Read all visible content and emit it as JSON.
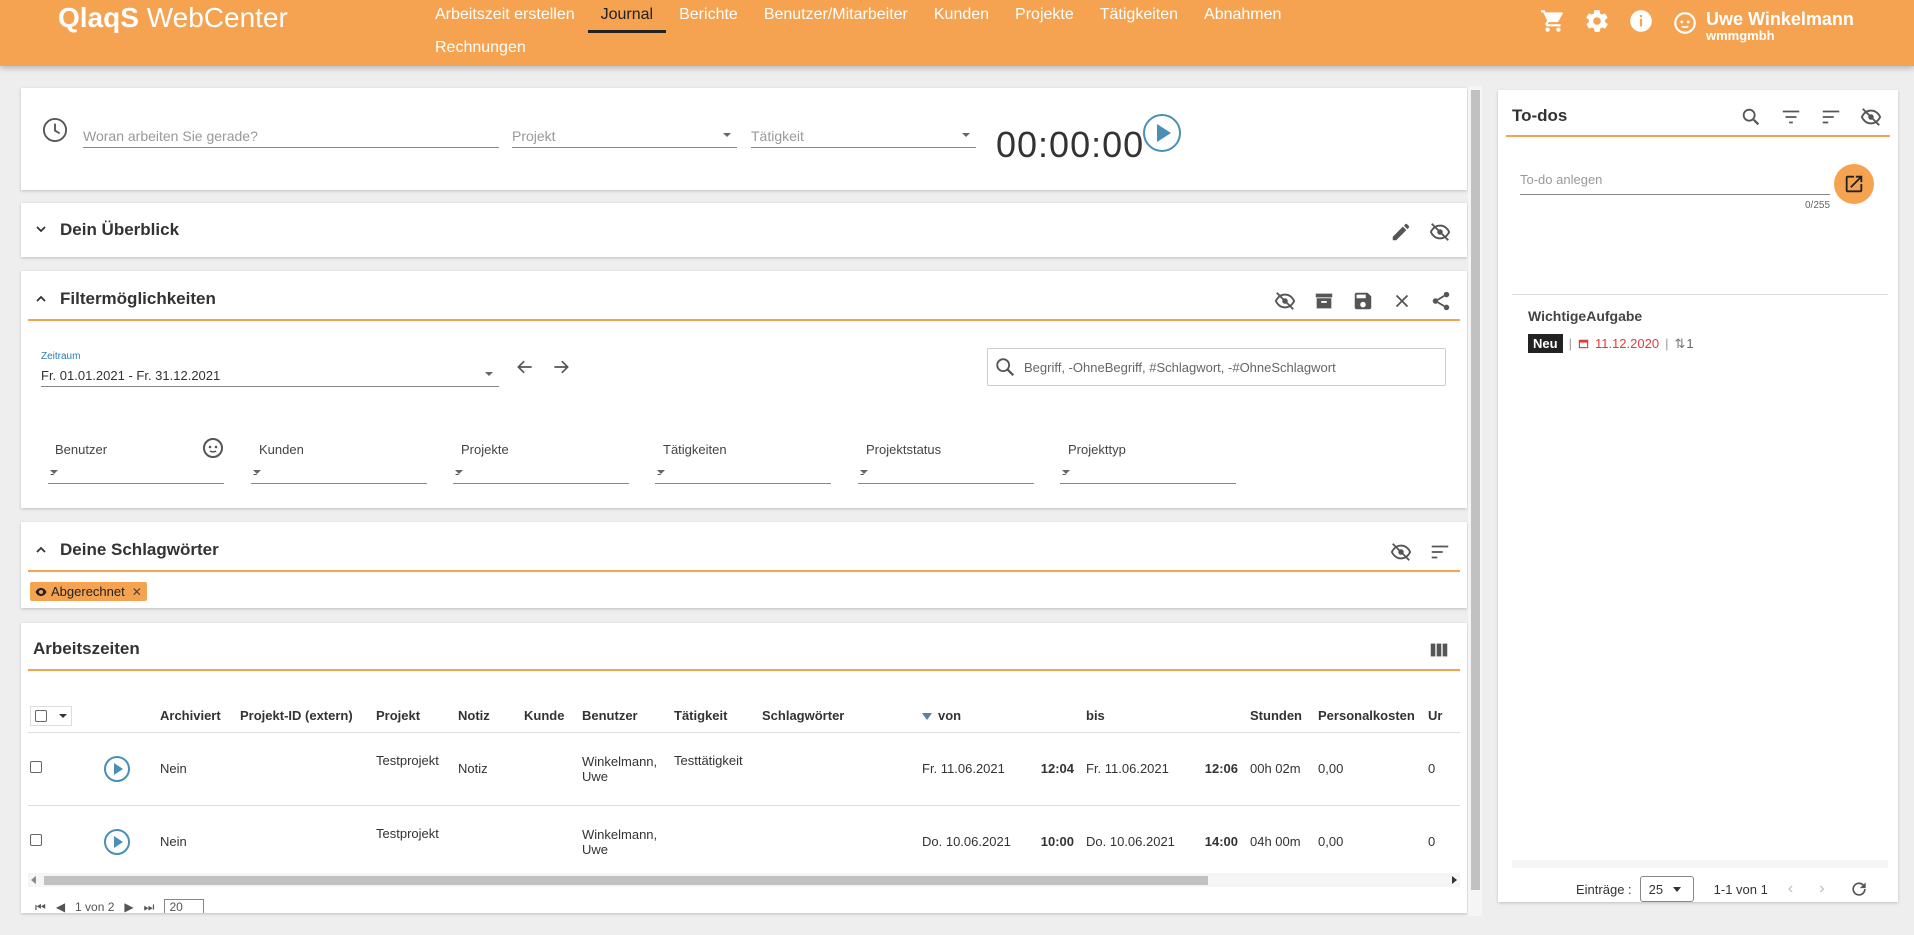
{
  "app": {
    "logo_brand": "QlaqS",
    "logo_suffix": "WebCenter"
  },
  "nav": [
    {
      "label": "Arbeitszeit erstellen",
      "active": false
    },
    {
      "label": "Journal",
      "active": true
    },
    {
      "label": "Berichte",
      "active": false
    },
    {
      "label": "Benutzer/Mitarbeiter",
      "active": false
    },
    {
      "label": "Kunden",
      "active": false
    },
    {
      "label": "Projekte",
      "active": false
    },
    {
      "label": "Tätigkeiten",
      "active": false
    },
    {
      "label": "Abnahmen",
      "active": false
    },
    {
      "label": "Rechnungen",
      "active": false
    }
  ],
  "user": {
    "name": "Uwe Winkelmann",
    "org": "wmmgmbh"
  },
  "timer": {
    "task_placeholder": "Woran arbeiten Sie gerade?",
    "project_placeholder": "Projekt",
    "activity_placeholder": "Tätigkeit",
    "time": "00:00:00"
  },
  "overview": {
    "title": "Dein Überblick"
  },
  "filters": {
    "title": "Filtermöglichkeiten",
    "period_label": "Zeitraum",
    "period_value": "Fr. 01.01.2021 - Fr. 31.12.2021",
    "search_placeholder": "Begriff, -OhneBegriff, #Schlagwort, -#OhneSchlagwort",
    "selects": [
      {
        "label": "Benutzer",
        "value": "-"
      },
      {
        "label": "Kunden",
        "value": "-"
      },
      {
        "label": "Projekte",
        "value": "-"
      },
      {
        "label": "Tätigkeiten",
        "value": "-"
      },
      {
        "label": "Projektstatus",
        "value": "-"
      },
      {
        "label": "Projekttyp",
        "value": "-"
      }
    ]
  },
  "tags": {
    "title": "Deine Schlagwörter",
    "chips": [
      {
        "label": "Abgerechnet"
      }
    ]
  },
  "worktimes": {
    "title": "Arbeitszeiten",
    "columns": [
      "Archiviert",
      "Projekt-ID (extern)",
      "Projekt",
      "Notiz",
      "Kunde",
      "Benutzer",
      "Tätigkeit",
      "Schlagwörter",
      "von",
      "",
      "bis",
      "",
      "Stunden",
      "Personalkosten",
      "Ur"
    ],
    "rows": [
      {
        "archived": "Nein",
        "ext_id": "",
        "project": "Testprojekt",
        "note": "Notiz",
        "customer": "",
        "user": "Winkelmann, Uwe",
        "activity": "Testtätigkeit",
        "tags": "",
        "from_date": "Fr. 11.06.2021",
        "from_time": "12:04",
        "to_date": "Fr. 11.06.2021",
        "to_time": "12:06",
        "hours": "00h 02m",
        "cost": "0,00",
        "extra": "0"
      },
      {
        "archived": "Nein",
        "ext_id": "",
        "project": "Testprojekt",
        "note": "",
        "customer": "",
        "user": "Winkelmann, Uwe",
        "activity": "",
        "tags": "",
        "from_date": "Do. 10.06.2021",
        "from_time": "10:00",
        "to_date": "Do. 10.06.2021",
        "to_time": "14:00",
        "hours": "04h 00m",
        "cost": "0,00",
        "extra": "0"
      }
    ],
    "pager_text": "1 von 2",
    "page_size": "20"
  },
  "todos": {
    "title": "To-dos",
    "input_placeholder": "To-do anlegen",
    "counter": "0/255",
    "item": {
      "title": "WichtigeAufgabe",
      "badge": "Neu",
      "date": "11.12.2020",
      "count": "1"
    },
    "entries_label": "Einträge :",
    "entries_value": "25",
    "range_text": "1-1 von 1"
  },
  "colors": {
    "accent": "#f5a351",
    "play": "#4a8fb5",
    "date_red": "#e53935"
  }
}
